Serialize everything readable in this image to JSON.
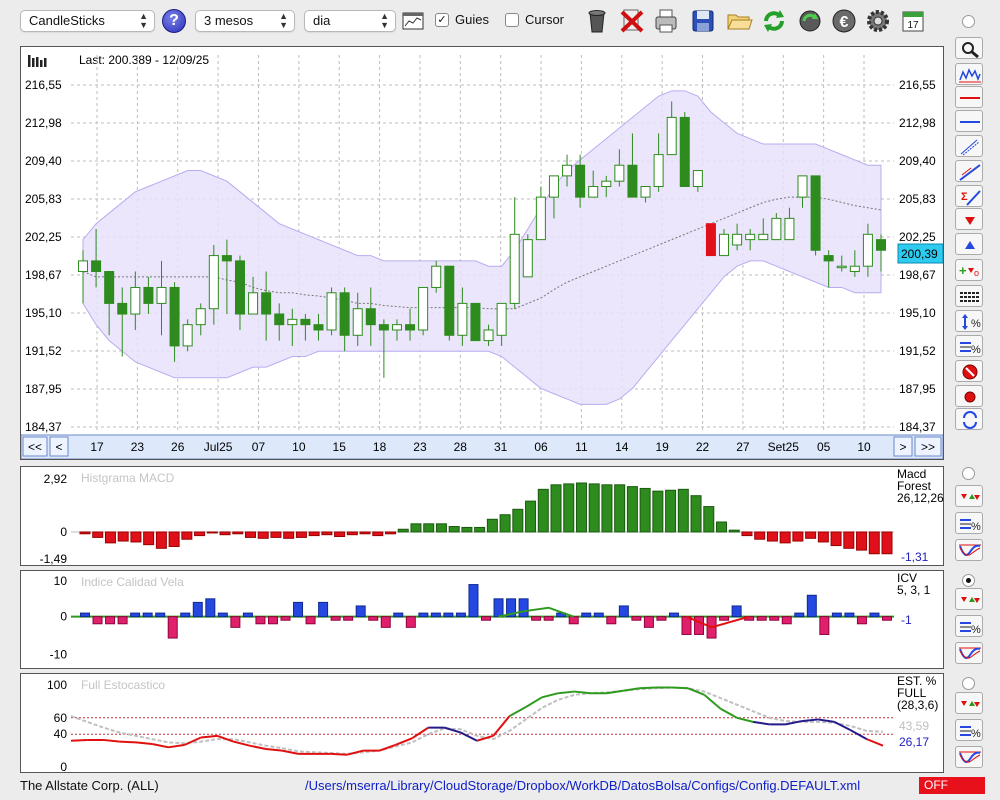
{
  "toolbar": {
    "chart_type": "CandleSticks",
    "period": "3 mesos",
    "interval": "dia",
    "guides_label": "Guies",
    "guides_checked": "✓",
    "cursor_label": "Cursor",
    "help": "?"
  },
  "main_chart": {
    "last_label": "Last: 200.389 - 12/09/25",
    "last_value": "200,39",
    "y_ticks": [
      "216,55",
      "212,98",
      "209,40",
      "205,83",
      "202,25",
      "198,67",
      "195,10",
      "191,52",
      "187,95",
      "184,37"
    ],
    "x_labels": [
      "17",
      "23",
      "26",
      "Jul25",
      "07",
      "10",
      "15",
      "18",
      "23",
      "28",
      "31",
      "06",
      "11",
      "14",
      "19",
      "22",
      "27",
      "Set25",
      "05",
      "10"
    ],
    "nav": {
      "first": "<<",
      "prev": "<",
      "next": ">",
      "last": ">>"
    },
    "y_min": 184.37,
    "y_max": 216.55,
    "candles": [
      [
        199,
        201,
        196,
        200
      ],
      [
        200,
        203,
        197.5,
        199
      ],
      [
        199,
        199,
        193,
        196
      ],
      [
        196,
        197.5,
        191,
        195
      ],
      [
        195,
        199,
        193.5,
        197.5
      ],
      [
        197.5,
        198.5,
        195,
        196
      ],
      [
        196,
        200,
        193,
        197.5
      ],
      [
        197.5,
        198,
        190.5,
        192
      ],
      [
        192,
        194.5,
        191.5,
        194
      ],
      [
        194,
        196,
        193,
        195.5
      ],
      [
        195.5,
        201.5,
        194,
        200.5
      ],
      [
        200.5,
        202,
        195,
        200
      ],
      [
        200,
        200.5,
        193.5,
        195
      ],
      [
        195,
        198.5,
        195,
        197
      ],
      [
        197,
        199,
        192.5,
        195
      ],
      [
        195,
        196,
        192.5,
        194
      ],
      [
        194,
        195.5,
        192,
        194.5
      ],
      [
        194.5,
        195,
        192.5,
        194
      ],
      [
        194,
        195,
        192.5,
        193.5
      ],
      [
        193.5,
        197.5,
        193,
        197
      ],
      [
        197,
        197.5,
        191.5,
        193
      ],
      [
        193,
        197,
        192,
        195.5
      ],
      [
        195.5,
        197.5,
        192,
        194
      ],
      [
        194,
        194.5,
        189,
        193.5
      ],
      [
        193.5,
        194.5,
        192.5,
        194
      ],
      [
        194,
        195.5,
        192.5,
        193.5
      ],
      [
        193.5,
        197.5,
        193,
        197.5
      ],
      [
        197.5,
        200,
        197,
        199.5
      ],
      [
        199.5,
        197.5,
        192.5,
        193
      ],
      [
        193,
        197.5,
        192,
        196
      ],
      [
        196,
        196,
        192.5,
        192.5
      ],
      [
        192.5,
        194,
        192,
        193.5
      ],
      [
        193,
        196,
        192,
        196
      ],
      [
        196,
        206,
        195.5,
        202.5
      ],
      [
        198.5,
        202.5,
        198.5,
        202
      ],
      [
        202,
        207,
        205,
        206
      ],
      [
        206,
        207.5,
        204,
        208
      ],
      [
        208,
        210,
        207,
        209
      ],
      [
        209,
        210,
        205,
        206
      ],
      [
        206,
        208.5,
        206,
        207
      ],
      [
        207,
        208,
        206,
        207.5
      ],
      [
        207.5,
        210.5,
        207,
        209
      ],
      [
        209,
        212,
        207,
        206
      ],
      [
        206,
        207,
        205.5,
        207
      ],
      [
        207,
        212,
        206.5,
        210
      ],
      [
        210,
        215,
        210,
        213.5
      ],
      [
        213.5,
        214,
        207,
        207
      ],
      [
        207,
        208,
        206.5,
        208.5
      ],
      [
        203.5,
        203.5,
        200.5,
        200.5
      ],
      [
        200.5,
        203,
        200.5,
        202.5
      ],
      [
        201.5,
        203.5,
        201,
        202.5
      ],
      [
        202,
        203,
        201,
        202.5
      ],
      [
        202,
        204,
        202,
        202.5
      ],
      [
        202,
        204.5,
        202,
        204
      ],
      [
        202,
        205,
        202,
        204
      ],
      [
        206,
        208,
        205,
        208
      ],
      [
        208,
        208,
        200.5,
        201
      ],
      [
        200.5,
        201,
        197.5,
        200
      ],
      [
        199.5,
        200.5,
        199,
        199.5
      ],
      [
        199,
        201,
        198.5,
        199.5
      ],
      [
        199.5,
        203.5,
        198.5,
        202.5
      ],
      [
        202,
        202.5,
        199,
        201
      ]
    ],
    "upper_band": [
      202,
      203.5,
      204.5,
      205.5,
      206.5,
      207,
      207.5,
      208,
      208.5,
      208.5,
      208,
      207.5,
      206.5,
      205.5,
      204.5,
      203.5,
      203,
      202.5,
      202,
      201.5,
      201,
      200.5,
      200.5,
      200,
      200,
      200,
      200,
      200,
      200,
      200,
      200,
      199.5,
      199.5,
      201,
      203,
      205,
      207,
      208.5,
      209.5,
      210.5,
      211.5,
      212.5,
      213.5,
      214.5,
      215.5,
      216,
      216,
      215.5,
      214,
      213,
      212,
      211.5,
      211,
      211,
      211,
      211,
      211,
      210.5,
      210,
      209.5,
      209,
      209
    ],
    "lower_band": [
      196,
      194,
      192.5,
      191.5,
      190.5,
      190,
      189.5,
      189,
      189,
      189,
      189,
      189,
      189.5,
      190,
      190,
      190.5,
      191,
      191,
      191.5,
      191.5,
      191.5,
      191.5,
      191.5,
      191.5,
      191.5,
      191.5,
      191.5,
      191.5,
      191.5,
      191.5,
      191.5,
      191.5,
      191,
      190,
      189,
      188,
      187.5,
      187,
      186.5,
      186.5,
      186.5,
      187,
      188,
      189.5,
      191,
      192.5,
      194,
      195.5,
      197,
      198.5,
      199.5,
      200,
      200,
      199.5,
      199,
      198.5,
      198,
      197.5,
      197.5,
      197,
      197,
      197
    ],
    "mid_band": [
      199,
      198.5,
      198.5,
      198.5,
      198.5,
      198.5,
      198.5,
      198.5,
      198.5,
      198.5,
      198.5,
      198.2,
      198,
      197.5,
      197.2,
      197,
      197,
      196.8,
      196.7,
      196.5,
      196.3,
      196,
      196,
      195.8,
      195.7,
      195.6,
      195.6,
      195.6,
      195.6,
      195.6,
      195.6,
      195.5,
      195.5,
      195.5,
      196,
      196.5,
      197.3,
      198,
      198.5,
      199,
      199.5,
      200,
      200.5,
      201,
      201.5,
      202,
      202.5,
      203,
      203.5,
      204,
      204.5,
      205,
      205.5,
      205.8,
      206,
      206,
      206,
      205.8,
      205.5,
      205.2,
      205,
      204.8
    ]
  },
  "macd": {
    "title": "Histgrama MACD",
    "label_line1": "Macd",
    "label_line2": "Forest",
    "label_line3": "26,12,26",
    "current": "-1,31",
    "y_ticks": [
      "2,92",
      "0",
      "-1,49"
    ],
    "y_min": -1.49,
    "y_max": 2.92,
    "values": [
      -0.1,
      -0.3,
      -0.6,
      -0.5,
      -0.55,
      -0.7,
      -0.9,
      -0.8,
      -0.4,
      -0.2,
      -0.05,
      -0.15,
      -0.1,
      -0.3,
      -0.35,
      -0.3,
      -0.35,
      -0.3,
      -0.2,
      -0.15,
      -0.25,
      -0.15,
      -0.1,
      -0.2,
      -0.1,
      0.15,
      0.45,
      0.45,
      0.45,
      0.3,
      0.25,
      0.25,
      0.7,
      0.95,
      1.25,
      1.7,
      2.35,
      2.6,
      2.65,
      2.7,
      2.65,
      2.6,
      2.6,
      2.5,
      2.4,
      2.25,
      2.3,
      2.35,
      2.0,
      1.4,
      0.55,
      0.1,
      -0.2,
      -0.4,
      -0.5,
      -0.6,
      -0.5,
      -0.35,
      -0.55,
      -0.75,
      -0.9,
      -1.0,
      -1.2,
      -1.2
    ]
  },
  "icv": {
    "title": "Indice Calidad Vela",
    "label_line1": "ICV",
    "label_line2": "5, 3, 1",
    "current": "-1",
    "y_ticks": [
      "10",
      "0",
      "-10"
    ],
    "y_min": -13,
    "y_max": 10,
    "values": [
      1,
      -2,
      -2,
      -2,
      1,
      1,
      1,
      -6,
      1,
      4,
      5,
      1,
      -3,
      1,
      -2,
      -2,
      -1,
      4,
      -2,
      4,
      -1,
      -1,
      3,
      -1,
      -3,
      1,
      -3,
      1,
      1,
      1,
      1,
      9,
      -1,
      5,
      5,
      5,
      -1,
      -1,
      1,
      -2,
      1,
      1,
      -2,
      3,
      -1,
      -3,
      -1,
      1,
      -5,
      -5,
      -6,
      -1,
      3,
      -1,
      -1,
      -1,
      -2,
      1,
      6,
      -5,
      1,
      1,
      -2,
      1,
      -1
    ]
  },
  "stoch": {
    "title": "Full Estocastico",
    "label_line1": "EST. %",
    "label_line2": "FULL",
    "label_line3": "(28,3,6)",
    "current_a": "43,59",
    "current_b": "26,17",
    "y_ticks": [
      "100",
      "60",
      "40",
      "0"
    ],
    "k": [
      32,
      33,
      33,
      31,
      30,
      28,
      24,
      27,
      36,
      38,
      31,
      26,
      22,
      20,
      16,
      16,
      16,
      15,
      20,
      20,
      27,
      35,
      48,
      48,
      42,
      32,
      38,
      62,
      73,
      85,
      90,
      92,
      90,
      90,
      93,
      96,
      97,
      97,
      96,
      88,
      71,
      60,
      55,
      52,
      52,
      56,
      58,
      55,
      45,
      34,
      26
    ],
    "d": [
      62,
      55,
      48,
      42,
      38,
      34,
      30,
      29,
      31,
      34,
      34,
      30,
      26,
      23,
      19,
      18,
      17,
      16,
      18,
      20,
      25,
      30,
      40,
      47,
      46,
      38,
      34,
      44,
      58,
      72,
      82,
      88,
      90,
      91,
      93,
      95,
      96,
      97,
      96,
      92,
      84,
      76,
      68,
      60,
      56,
      55,
      55,
      54,
      50,
      44,
      43
    ]
  },
  "status": {
    "company": "The Allstate Corp. (ALL)",
    "path": "/Users/mserra/Library/CloudStorage/Dropbox/WorkDB/DatosBolsa/Configs/Config.DEFAULT.xml",
    "state": "OFF"
  },
  "colors": {
    "up": "#2e8b1e",
    "down": "#e0101a",
    "band_fill": "#e7e2fa",
    "band_line": "#b8acf0",
    "macd_bar": "#2e8b1e",
    "macd_neg": "#e0101a",
    "icv_pos": "#2448e0",
    "icv_neg": "#e0206a",
    "icv_line": "#2e9b1e",
    "stoch_red": "#e01010",
    "stoch_navy": "#241a8a",
    "stoch_green": "#2e9b1e",
    "stoch_gray": "#c0c0c0",
    "last_box": "#2ecbf0"
  },
  "icons": {
    "toolbar": [
      "chart-thumb-icon",
      "trash-icon",
      "delete-icon",
      "print-icon",
      "save-icon",
      "open-folder-icon",
      "refresh-icon",
      "sync-icon",
      "currency-icon",
      "gear-icon",
      "calendar-icon"
    ],
    "sidebar": [
      "zoom-icon",
      "bars-icon",
      "red-line-icon",
      "blue-line-icon",
      "channel-icon",
      "trendline-icon",
      "sigma-icon",
      "down-arrow-icon",
      "up-arrow-icon",
      "add-remove-icon",
      "grid-icon",
      "percent-range-icon",
      "percent-lines-icon",
      "stop-icon",
      "record-icon",
      "swap-icon"
    ]
  },
  "calendar_day": "17"
}
